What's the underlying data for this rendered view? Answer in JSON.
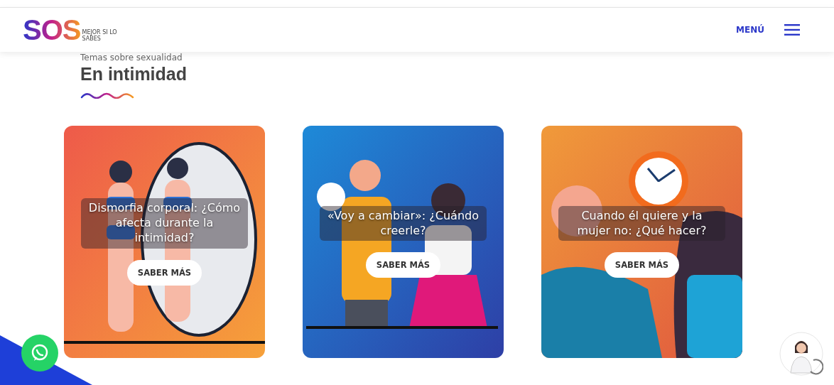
{
  "header": {
    "logo": "SOS",
    "tagline": "MEJOR SI LO SABES",
    "menu_label": "MENÚ"
  },
  "section": {
    "eyebrow": "Temas sobre sexualidad",
    "title": "En intimidad"
  },
  "cards": [
    {
      "kind": "picture",
      "title": "Dismorfia corporal: ¿Cómo afecta durante la intimidad?",
      "button": "SABER MÁS"
    },
    {
      "kind": "picture",
      "title": "«Voy a cambiar»: ¿Cuándo creerle?",
      "button": "SABER MÁS"
    },
    {
      "kind": "picture",
      "title": "Cuando él quiere y la mujer no: ¿Qué hacer?",
      "button": "SABER MÁS"
    }
  ]
}
